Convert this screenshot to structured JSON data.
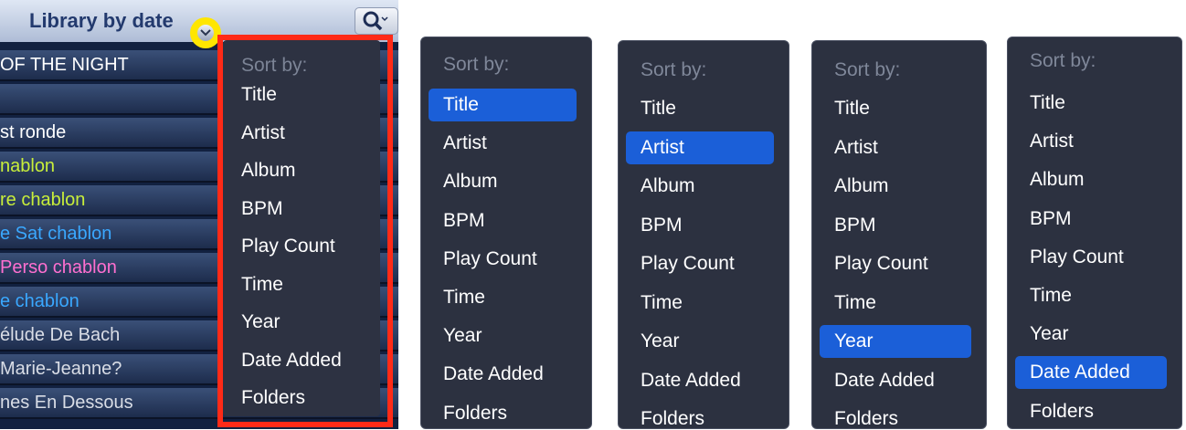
{
  "library": {
    "title": "Library by date",
    "rows": [
      {
        "text": "OF THE NIGHT",
        "color": "#ffffff"
      },
      {
        "text": "",
        "color": "#ffffff"
      },
      {
        "text": "st ronde",
        "color": "#ffffff"
      },
      {
        "text": "nablon",
        "color": "#c8ee3a"
      },
      {
        "text": "re chablon",
        "color": "#c8ee3a"
      },
      {
        "text": "e Sat chablon",
        "color": "#3aa8ff"
      },
      {
        "text": "Perso chablon",
        "color": "#ff6fd0"
      },
      {
        "text": "e chablon",
        "color": "#3aa8ff"
      },
      {
        "text": "élude De Bach",
        "color": "#d9dde6"
      },
      {
        "text": " Marie-Jeanne?",
        "color": "#d9dde6"
      },
      {
        "text": "nes En Dessous",
        "color": "#d9dde6"
      }
    ]
  },
  "sort_menu": {
    "header": "Sort by:",
    "options": [
      "Title",
      "Artist",
      "Album",
      "BPM",
      "Play Count",
      "Time",
      "Year",
      "Date Added",
      "Folders"
    ]
  },
  "menus": [
    {
      "selected": "Title"
    },
    {
      "selected": "Artist"
    },
    {
      "selected": "Year"
    },
    {
      "selected": "Date Added"
    }
  ],
  "colors": {
    "highlight": "#1b5fd8",
    "menu_bg": "#2c3140",
    "annotation_frame": "#ff2a17",
    "annotation_circle": "#ffe600"
  }
}
